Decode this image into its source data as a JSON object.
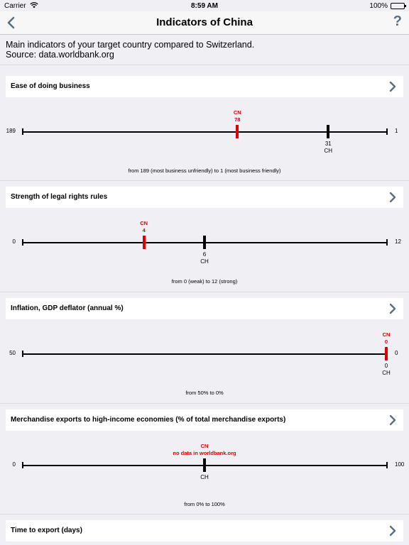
{
  "status_bar": {
    "carrier": "Carrier",
    "time": "8:59 AM",
    "battery": "100%"
  },
  "nav": {
    "title": "Indicators of China",
    "help_label": "?"
  },
  "intro": {
    "line1": "Main indicators of your target country compared to Switzerland.",
    "line2": "Source: data.worldbank.org"
  },
  "country_code": "CN",
  "compare_code": "CH",
  "colors": {
    "target": "#e00000",
    "compare": "#000000",
    "background": "#efeff4"
  },
  "sections": [
    {
      "title": "Ease of doing business",
      "min_label": "189",
      "max_label": "1",
      "scale_min": 189,
      "scale_max": 1,
      "cn_value": 78,
      "cn_text": "78",
      "ch_value": 31,
      "ch_text": "31",
      "caption": "from 189 (most business unfriendly) to 1 (most business friendly)"
    },
    {
      "title": "Strength of legal rights rules",
      "min_label": "0",
      "max_label": "12",
      "scale_min": 0,
      "scale_max": 12,
      "cn_value": 4,
      "cn_text": "4",
      "ch_value": 6,
      "ch_text": "6",
      "caption": "from 0 (weak) to 12 (strong)"
    },
    {
      "title": "Inflation, GDP deflator (annual %)",
      "min_label": "50",
      "max_label": "0",
      "scale_min": 50,
      "scale_max": 0,
      "cn_value": 0,
      "cn_text": "0",
      "ch_value": 0,
      "ch_text": "0",
      "caption": "from 50% to 0%"
    },
    {
      "title": "Merchandise exports to high-income economies (% of total merchandise exports)",
      "min_label": "0",
      "max_label": "100",
      "scale_min": 0,
      "scale_max": 100,
      "cn_value": null,
      "cn_text": "no data in worldbank.org",
      "ch_value": 50,
      "ch_text": "",
      "caption": "from 0% to 100%"
    },
    {
      "title": "Time to export (days)"
    }
  ]
}
